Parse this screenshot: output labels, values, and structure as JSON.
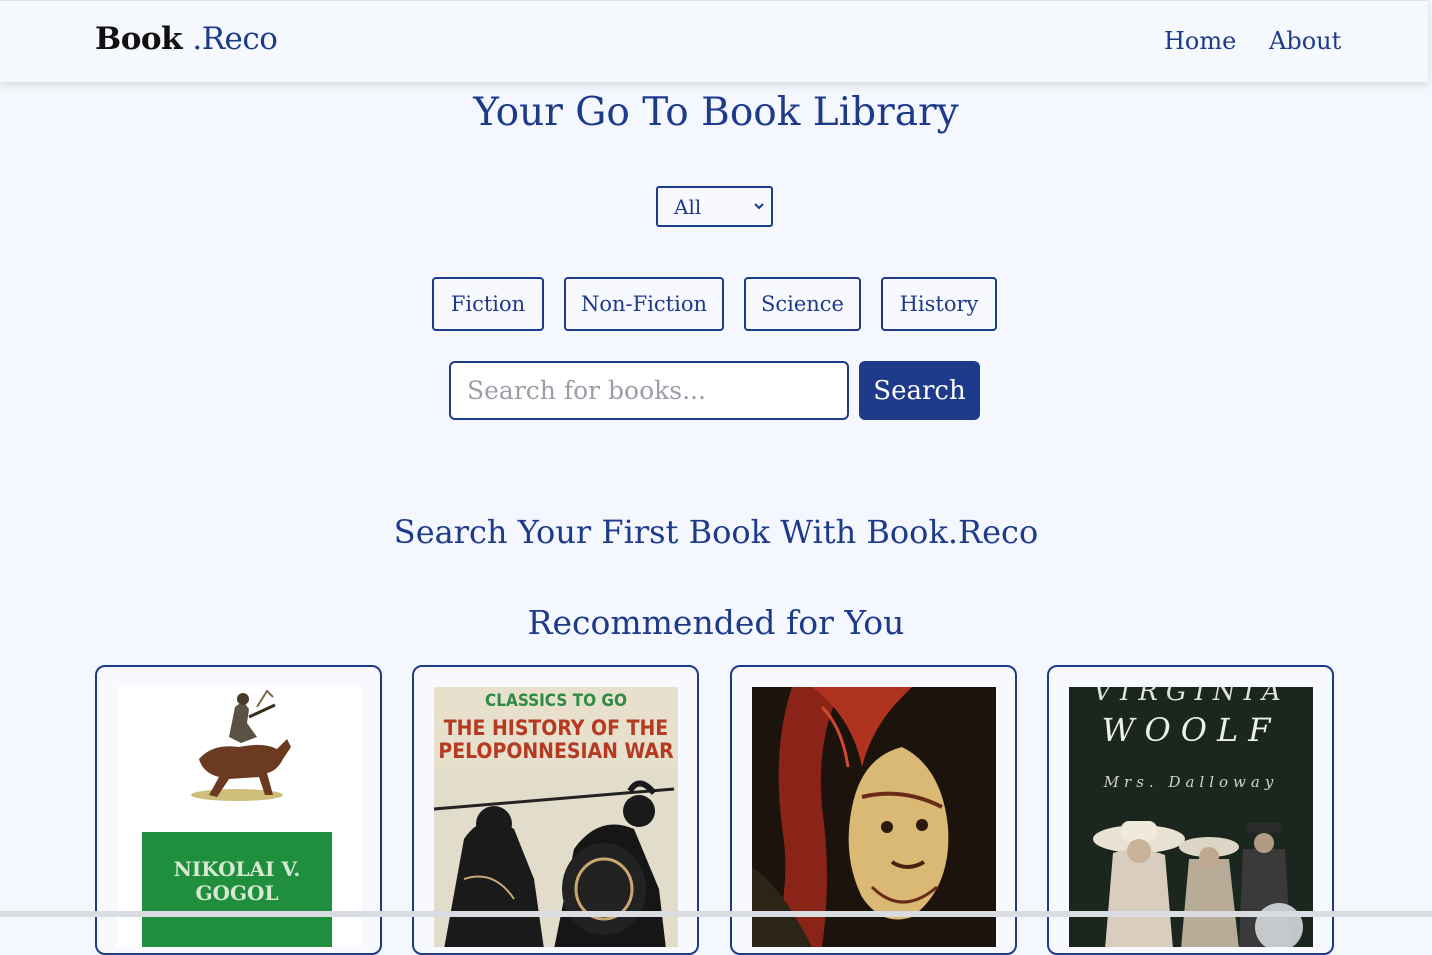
{
  "navbar": {
    "logo_part1": "Book",
    "logo_part2": ".Reco",
    "links": [
      "Home",
      "About"
    ]
  },
  "hero": {
    "title": "Your Go To Book Library"
  },
  "filter": {
    "selected": "All"
  },
  "categories": [
    "Fiction",
    "Non-Fiction",
    "Science",
    "History"
  ],
  "search": {
    "placeholder": "Search for books...",
    "button_label": "Search"
  },
  "empty_message": "Search Your First Book With Book.Reco",
  "recommended": {
    "heading": "Recommended for You",
    "books": [
      {
        "cover_text_1": "NIKOLAI V.",
        "cover_text_2": "GOGOL"
      },
      {
        "cover_text_1": "CLASSICS TO GO",
        "cover_text_2": "THE HISTORY OF THE",
        "cover_text_3": "PELOPONNESIAN WAR"
      },
      {},
      {
        "cover_text_1": "VIRGINIA",
        "cover_text_2": "WOOLF",
        "cover_text_3": "Mrs. Dalloway"
      }
    ]
  },
  "colors": {
    "primary": "#1e3a8a",
    "background": "#f4f7fd",
    "logo_dark": "#111111"
  }
}
